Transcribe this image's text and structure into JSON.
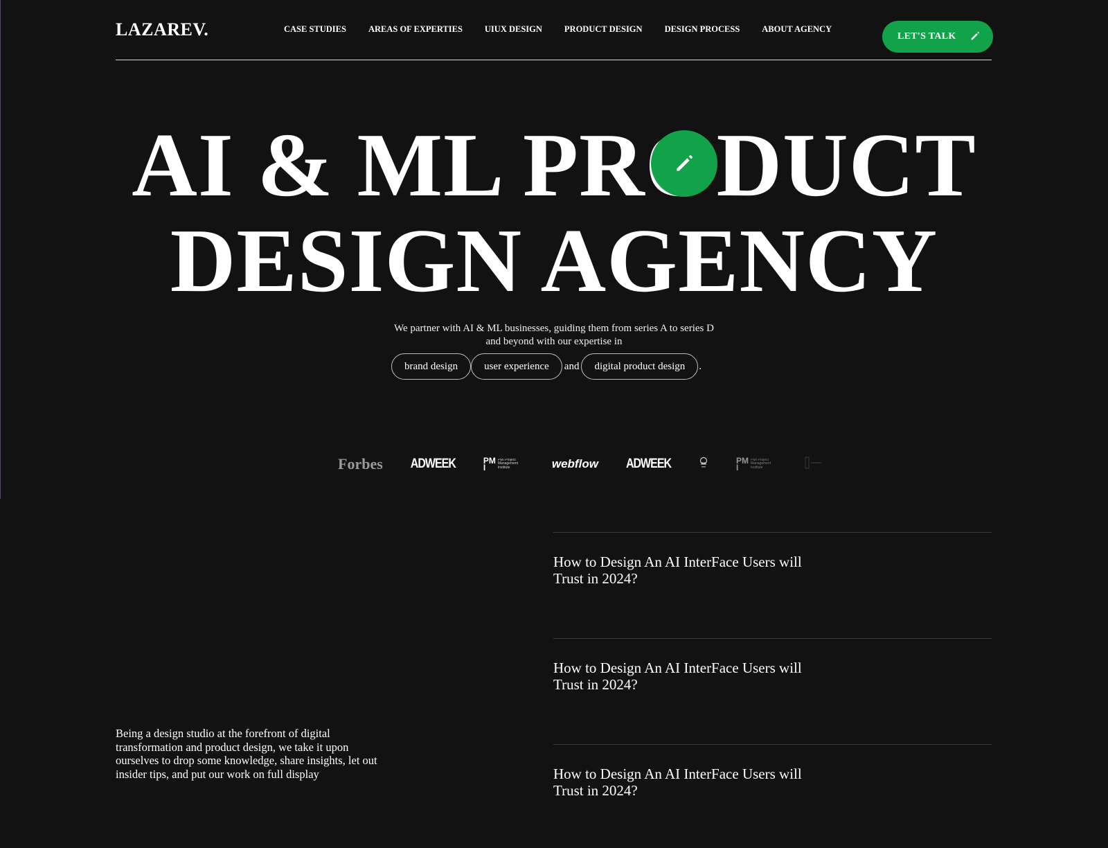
{
  "header": {
    "logo": "LAZAREV.",
    "nav": [
      "CASE STUDIES",
      "AREAS OF EXPERTIES",
      "UIUX DESIGN",
      "PRODUCT DESIGN",
      "DESIGN PROCESS",
      "ABOUT AGENCY"
    ],
    "cta_label": "LET'S TALK",
    "cta_icon": "pencil-icon"
  },
  "hero": {
    "line1": "AI & ML PRODUCT",
    "line2": "DESIGN AGENCY",
    "badge_icon": "pencil-icon",
    "lead": "We partner with AI & ML businesses, guiding them from series A to series D and beyond with our expertise in",
    "pills": [
      "brand design",
      "user experience",
      "digital product design"
    ],
    "connector": "and",
    "end_mark": "."
  },
  "press_logos": [
    "Forbes",
    "ADWEEK",
    "PMI Project Management Institute",
    "webflow",
    "ADWEEK",
    "awards-icon",
    "PMI Project Management Institute",
    "faded-logo"
  ],
  "about_text": "Being a design studio at the forefront of digital transformation and product design, we take it upon ourselves to drop some knowledge, share insights, let out insider tips, and put our work on full display",
  "articles": [
    {
      "title": "How to Design An AI InterFace Users will Trust in 2024?"
    },
    {
      "title": "How to Design An AI InterFace Users will Trust in 2024?"
    },
    {
      "title": "How to Design An AI InterFace Users will Trust in 2024?"
    }
  ],
  "colors": {
    "background": "#121212",
    "accent": "#12a24a",
    "text": "#ffffff"
  }
}
